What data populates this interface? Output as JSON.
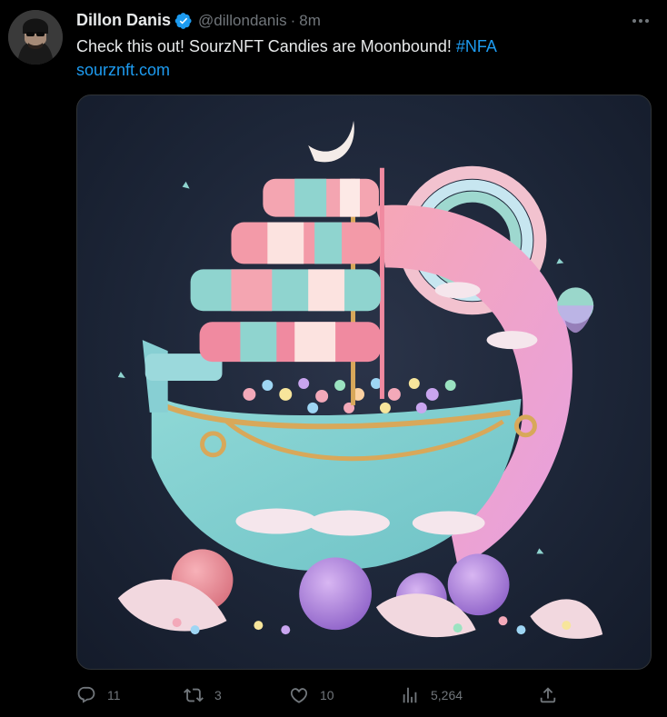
{
  "tweet": {
    "author_name": "Dillon Danis",
    "handle": "@dillondanis",
    "separator": "·",
    "time": "8m",
    "text_main": "Check this out! SourzNFT Candies are Moonbound! ",
    "hashtag": "#NFA",
    "link": "sourznft.com"
  },
  "stats": {
    "replies": "11",
    "retweets": "3",
    "likes": "10",
    "views": "5,264"
  },
  "colors": {
    "accent": "#1d9bf0",
    "muted": "#71767b",
    "background": "#000000"
  },
  "icons": [
    "verified-badge-icon",
    "more-icon",
    "reply-icon",
    "retweet-icon",
    "like-icon",
    "views-icon",
    "share-icon"
  ]
}
